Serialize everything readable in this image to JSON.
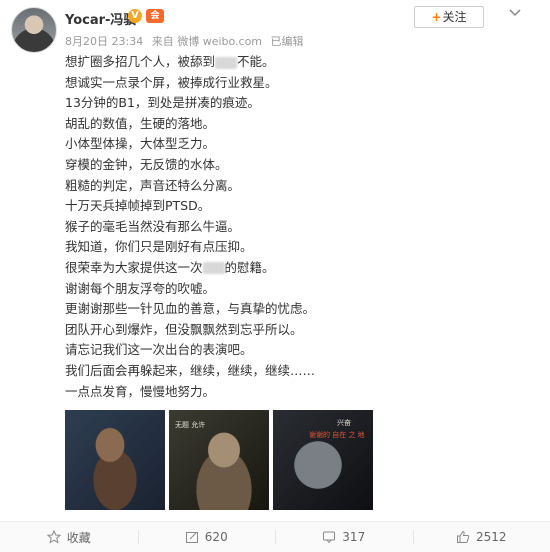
{
  "post": {
    "username": "Yocar-冯骥",
    "verified_badge": "V",
    "vip_badge": "会",
    "meta": {
      "date": "8月20日 23:34",
      "source": "来自 微博 weibo.com",
      "edited": "已编辑"
    },
    "follow_label": "关注",
    "lines": [
      [
        "想扩圈多招几个人，被舔到",
        "[blur]",
        "不能。"
      ],
      [
        "想诚实一点录个屏，被捧成行业救星。"
      ],
      [
        "13分钟的B1，到处是拼凑的痕迹。"
      ],
      [
        "胡乱的数值，生硬的落地。"
      ],
      [
        "小体型体操，大体型乏力。"
      ],
      [
        "穿模的金钟，无反馈的水体。"
      ],
      [
        "粗糙的判定，声音还特么分离。"
      ],
      [
        "十万天兵掉帧掉到PTSD。"
      ],
      [
        "猴子的毫毛当然没有那么牛逼。"
      ],
      [
        "我知道，你们只是刚好有点压抑。"
      ],
      [
        "很荣幸为大家提供这一次",
        "[blur]",
        "的慰籍。"
      ],
      [
        "谢谢每个朋友浮夸的吹嘘。"
      ],
      [
        "更谢谢那些一针见血的善意，与真挚的忧虑。"
      ],
      [
        "团队开心到爆炸，但没飘飘然到忘乎所以。"
      ],
      [
        "请忘记我们这一次出台的表演吧。"
      ],
      [
        "我们后面会再躲起来，继续，继续，继续……"
      ],
      [
        "一点点发育，慢慢地努力。"
      ]
    ],
    "images": [
      {
        "name": "game-screenshot-1",
        "text": []
      },
      {
        "name": "game-screenshot-2",
        "text": [
          "无题 允许"
        ]
      },
      {
        "name": "game-screenshot-3",
        "text": [
          "兴奋",
          "谢谢的 自在 之 地"
        ]
      }
    ]
  },
  "actions": {
    "favorite_label": "收藏",
    "repost_count": "620",
    "comment_count": "317",
    "like_count": "2512"
  },
  "colors": {
    "accent": "#ff8200",
    "text": "#333333",
    "muted": "#999999"
  }
}
